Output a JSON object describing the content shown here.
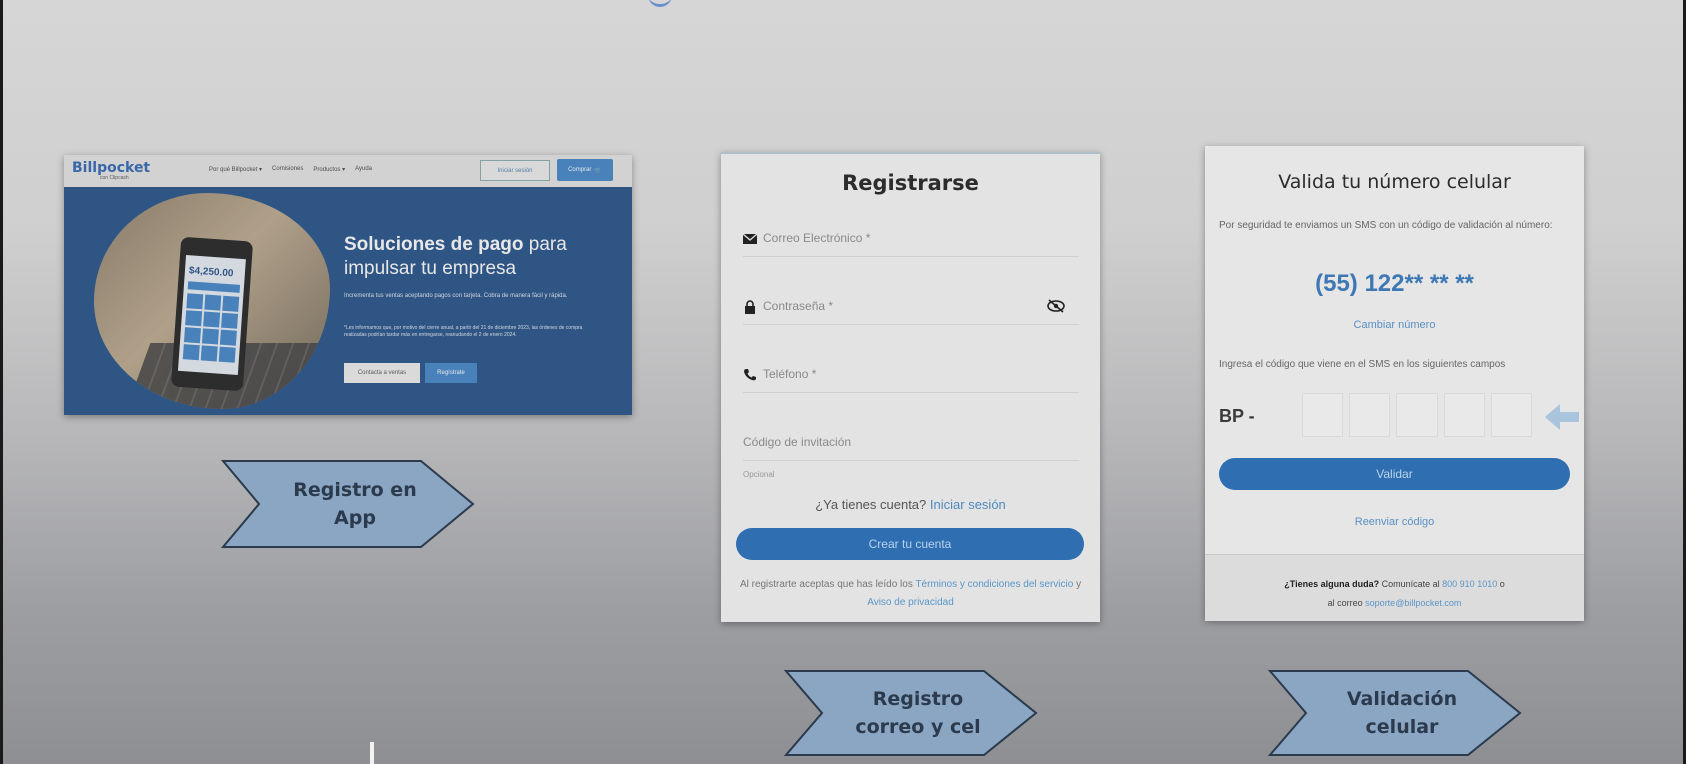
{
  "app": {
    "nav": {
      "logo": "Billpocket",
      "logo_sub": "con Clipcash",
      "links": [
        "Por qué Billpocket ▾",
        "Comisiones",
        "Productos ▾",
        "Ayuda"
      ],
      "login_button": "Iniciar sesión",
      "buy_button": "Comprar"
    },
    "hero": {
      "amount": "$4,250.00",
      "headline_bold_1": "Soluciones de pago",
      "headline_regular_1": " para",
      "headline_bold_2": "impulsar tu empresa",
      "subtitle": "Incrementa tus ventas aceptando pagos con tarjeta. Cobra de manera fácil y rápida.",
      "note": "*Les informamos que, por motivo del cierre anual, a partir del 21 de diciembre 2023, las órdenes de compra realizadas podrían tardar más en entregarse, reanudando el 2 de enero 2024.",
      "contact_button": "Contacta a ventas",
      "register_button": "Regístrate"
    }
  },
  "register": {
    "title": "Registrarse",
    "email_placeholder": "Correo Electrónico *",
    "password_placeholder": "Contraseña *",
    "phone_placeholder": "Teléfono *",
    "invite_placeholder": "Código de invitación",
    "invite_hint": "Opcional",
    "have_account": "¿Ya tienes cuenta?",
    "login_link": "Iniciar sesión",
    "create_button": "Crear tu cuenta",
    "terms_prefix": "Al registrarte aceptas que has leído los",
    "terms_link": "Términos y condiciones del servicio",
    "terms_and": "y",
    "privacy_link": "Aviso de privacidad"
  },
  "validate": {
    "title": "Valida tu número celular",
    "sms_text": "Por seguridad te enviamos un SMS con un código de validación al número:",
    "phone_number": "(55) 122** ** **",
    "change_number": "Cambiar número",
    "code_instructions": "Ingresa el código que viene en el SMS en los siguientes campos",
    "code_prefix": "BP -",
    "validate_button": "Validar",
    "resend_code": "Reenviar código",
    "help_question": "¿Tienes alguna duda?",
    "help_contact": "Comunícate al",
    "help_phone": "800 910 1010",
    "help_or": "o",
    "help_mail_prefix": "al correo",
    "help_mail": "soporte@billpocket.com"
  },
  "steps": {
    "step1": [
      "Registro en",
      "App"
    ],
    "step2": [
      "Registro",
      "correo y cel"
    ],
    "step3": [
      "Validación",
      "celular"
    ]
  },
  "colors": {
    "accent": "#2f6fb1",
    "arrow_fill": "#8aa6c2",
    "arrow_stroke": "#2b3a4d",
    "hero_bg": "#1f4d86"
  }
}
